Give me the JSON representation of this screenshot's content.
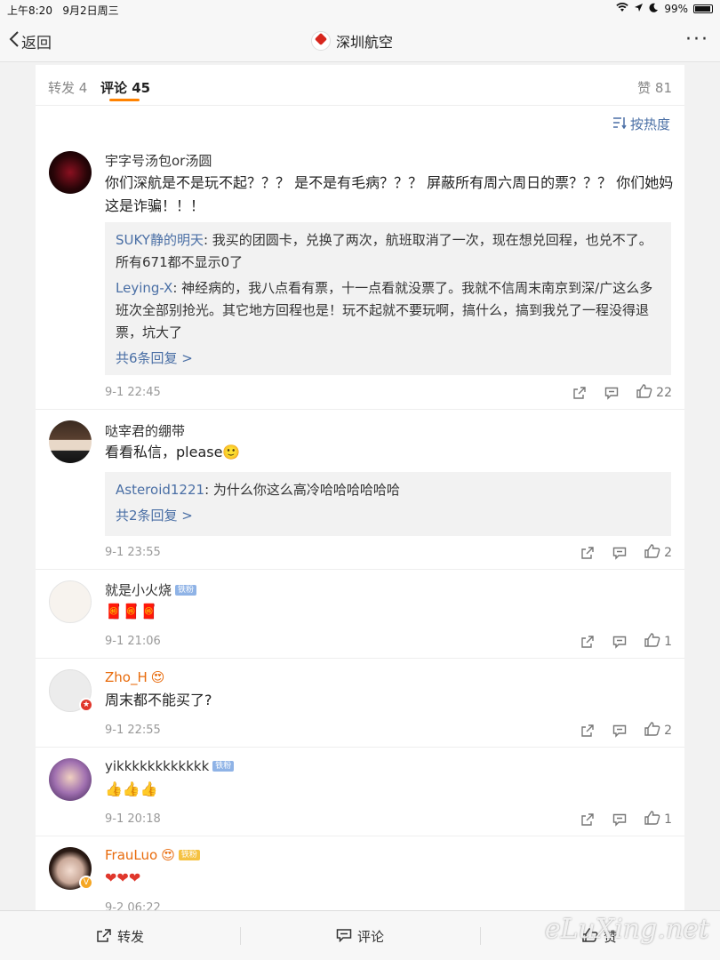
{
  "status_bar": {
    "time": "上午8:20",
    "date": "9月2日周三",
    "battery": "99%"
  },
  "nav": {
    "back_label": "返回",
    "title": "深圳航空"
  },
  "tabs": {
    "repost": "转发 4",
    "comment": "评论 45",
    "like": "赞 81"
  },
  "sort_label": "按热度",
  "comments": [
    {
      "name": "宇字号汤包or汤圆",
      "text": "你们深航是不是玩不起？？？ 是不是有毛病？？？ 屏蔽所有周六周日的票？？？ 你们她妈这是诈骗！！！",
      "replies": [
        {
          "name": "SUKY静的明天",
          "text": ": 我买的团圆卡，兑换了两次，航班取消了一次，现在想兑回程，也兑不了。所有671都不显示0了"
        },
        {
          "name": "Leying-X",
          "text": ": 神经病的，我八点看有票，十一点看就没票了。我就不信周末南京到深/广这么多班次全部别抢光。其它地方回程也是！玩不起就不要玩啊，搞什么，搞到我兑了一程没得退票，坑大了"
        }
      ],
      "more_replies": "共6条回复 >",
      "time": "9-1 22:45",
      "likes": "22"
    },
    {
      "name": "哒宰君的绷带",
      "text": "看看私信，please🙂",
      "replies": [
        {
          "name": "Asteroid1221",
          "text": ": 为什么你这么高冷哈哈哈哈哈哈"
        }
      ],
      "more_replies": "共2条回复 >",
      "time": "9-1 23:55",
      "likes": "2"
    },
    {
      "name": "就是小火烧",
      "badge": "铁粉",
      "text": "🧧🧧🧧",
      "time": "9-1 21:06",
      "likes": "1"
    },
    {
      "name": "Zho_H",
      "text": "周末都不能买了?",
      "time": "9-1 22:55",
      "likes": "2"
    },
    {
      "name": "yikkkkkkkkkkkk",
      "badge": "铁粉",
      "text": "👍👍👍",
      "time": "9-1 20:18",
      "likes": "1"
    },
    {
      "name": "FrauLuo",
      "badge": "铁粉",
      "text": "❤❤❤",
      "time": "9-2 06:22",
      "likes": ""
    }
  ],
  "bottom_bar": {
    "repost": "转发",
    "comment": "评论",
    "like": "赞"
  },
  "watermark": "eLuXing.net",
  "colors": {
    "accent": "#ff8200",
    "link": "#4a6fa5",
    "name_orange": "#e86b0c"
  }
}
